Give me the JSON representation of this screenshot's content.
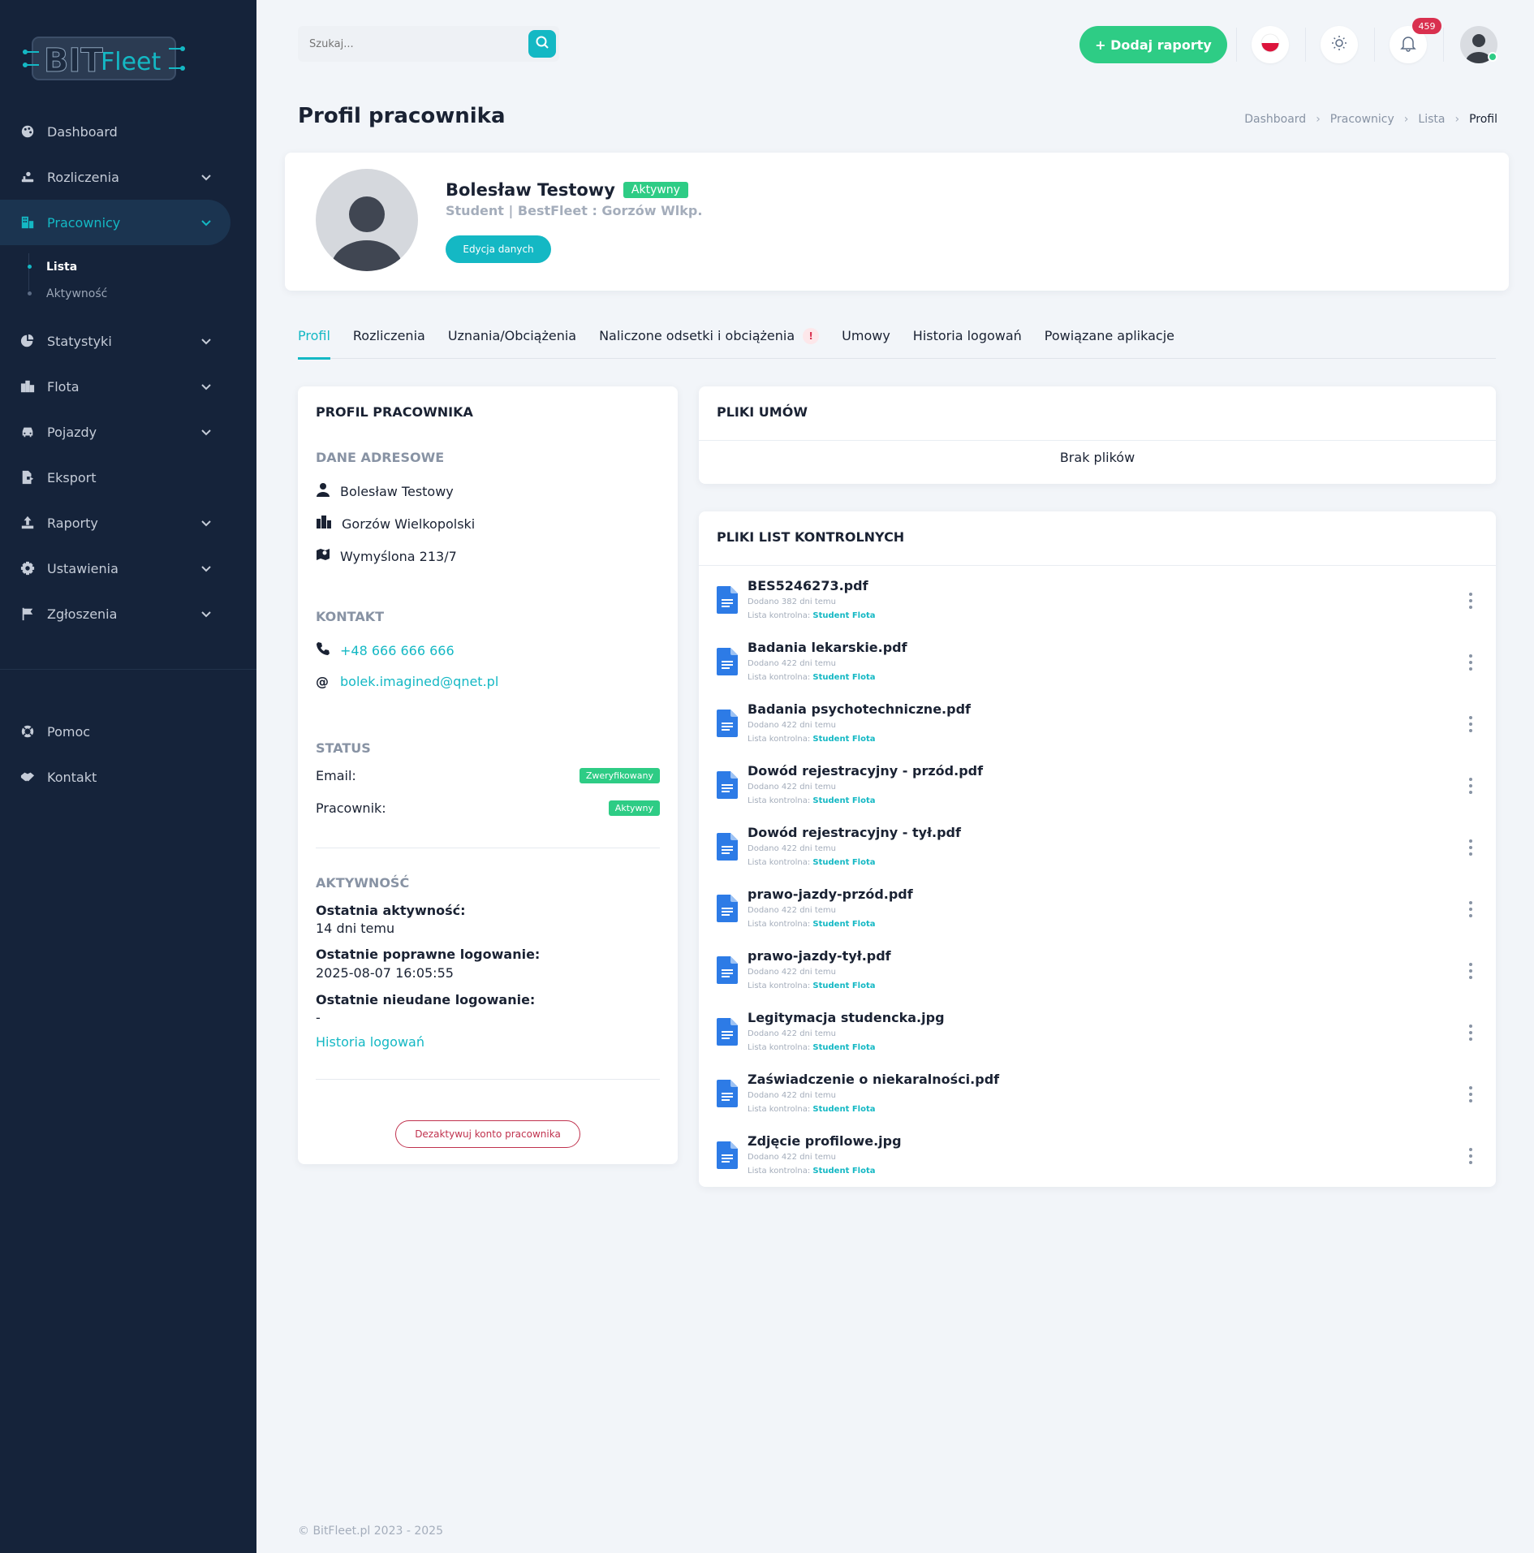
{
  "brand": {
    "logo_bit": "BIT",
    "logo_fleet": "Fleet",
    "accent": "#14b8c4",
    "sidebar_bg": "#15233a",
    "success": "#2ecc85",
    "danger": "#d9304f"
  },
  "sidebar": {
    "items": [
      {
        "label": "Dashboard",
        "icon": "palette-icon",
        "chevron": false
      },
      {
        "label": "Rozliczenia",
        "icon": "hand-coins-icon",
        "chevron": true
      },
      {
        "label": "Pracownicy",
        "icon": "users-building-icon",
        "chevron": true,
        "active": true
      },
      {
        "label": "Statystyki",
        "icon": "pie-chart-icon",
        "chevron": true
      },
      {
        "label": "Flota",
        "icon": "city-icon",
        "chevron": true
      },
      {
        "label": "Pojazdy",
        "icon": "car-icon",
        "chevron": true
      },
      {
        "label": "Eksport",
        "icon": "file-export-icon",
        "chevron": false
      },
      {
        "label": "Raporty",
        "icon": "upload-icon",
        "chevron": true
      },
      {
        "label": "Ustawienia",
        "icon": "gear-icon",
        "chevron": true
      },
      {
        "label": "Zgłoszenia",
        "icon": "flag-icon",
        "chevron": true
      }
    ],
    "subitems": [
      {
        "label": "Lista",
        "active": true
      },
      {
        "label": "Aktywność",
        "active": false
      }
    ],
    "bottom": [
      {
        "label": "Pomoc",
        "icon": "lifebuoy-icon"
      },
      {
        "label": "Kontakt",
        "icon": "handshake-icon"
      }
    ]
  },
  "topbar": {
    "search_placeholder": "Szukaj...",
    "add_report_label": "+ Dodaj raporty",
    "notifications_count": "459"
  },
  "page": {
    "title": "Profil pracownika",
    "breadcrumb": [
      "Dashboard",
      "Pracownicy",
      "Lista",
      "Profil"
    ]
  },
  "profile": {
    "name": "Bolesław Testowy",
    "status_badge": "Aktywny",
    "subtitle": "Student | BestFleet : Gorzów Wlkp.",
    "edit_label": "Edycja danych"
  },
  "tabs": [
    "Profil",
    "Rozliczenia",
    "Uznania/Obciążenia",
    "Naliczone odsetki i obciążenia",
    "Umowy",
    "Historia logowań",
    "Powiązane aplikacje"
  ],
  "tab_warning": "!",
  "left_panel": {
    "title": "PROFIL PRACOWNIKA",
    "address_header": "DANE ADRESOWE",
    "address": {
      "name": "Bolesław Testowy",
      "city": "Gorzów Wielkopolski",
      "street": "Wymyślona 213/7"
    },
    "contact_header": "KONTAKT",
    "contact": {
      "phone": "+48 666 666 666",
      "email": "bolek.imagined@qnet.pl"
    },
    "status_header": "STATUS",
    "status": [
      {
        "label": "Email:",
        "badge": "Zweryfikowany"
      },
      {
        "label": "Pracownik:",
        "badge": "Aktywny"
      }
    ],
    "activity_header": "AKTYWNOŚĆ",
    "activity": [
      {
        "label": "Ostatnia aktywność:",
        "value": "14 dni temu"
      },
      {
        "label": "Ostatnie poprawne logowanie:",
        "value": "2025-08-07 16:05:55"
      },
      {
        "label": "Ostatnie nieudane logowanie:",
        "value": "-"
      }
    ],
    "history_link": "Historia logowań",
    "deactivate_label": "Dezaktywuj konto pracownika"
  },
  "contracts_panel": {
    "title": "PLIKI UMÓW",
    "empty": "Brak plików"
  },
  "checklist_panel": {
    "title": "PLIKI LIST KONTROLNYCH",
    "list_label": "Lista kontrolna:",
    "files": [
      {
        "name": "BES5246273.pdf",
        "added": "Dodano 382 dni temu",
        "list": "Student Flota"
      },
      {
        "name": "Badania lekarskie.pdf",
        "added": "Dodano 422 dni temu",
        "list": "Student Flota"
      },
      {
        "name": "Badania psychotechniczne.pdf",
        "added": "Dodano 422 dni temu",
        "list": "Student Flota"
      },
      {
        "name": "Dowód rejestracyjny - przód.pdf",
        "added": "Dodano 422 dni temu",
        "list": "Student Flota"
      },
      {
        "name": "Dowód rejestracyjny - tył.pdf",
        "added": "Dodano 422 dni temu",
        "list": "Student Flota"
      },
      {
        "name": "prawo-jazdy-przód.pdf",
        "added": "Dodano 422 dni temu",
        "list": "Student Flota"
      },
      {
        "name": "prawo-jazdy-tył.pdf",
        "added": "Dodano 422 dni temu",
        "list": "Student Flota"
      },
      {
        "name": "Legitymacja studencka.jpg",
        "added": "Dodano 422 dni temu",
        "list": "Student Flota"
      },
      {
        "name": "Zaświadczenie o niekaralności.pdf",
        "added": "Dodano 422 dni temu",
        "list": "Student Flota"
      },
      {
        "name": "Zdjęcie profilowe.jpg",
        "added": "Dodano 422 dni temu",
        "list": "Student Flota"
      }
    ]
  },
  "footer": "© BitFleet.pl 2023 - 2025"
}
